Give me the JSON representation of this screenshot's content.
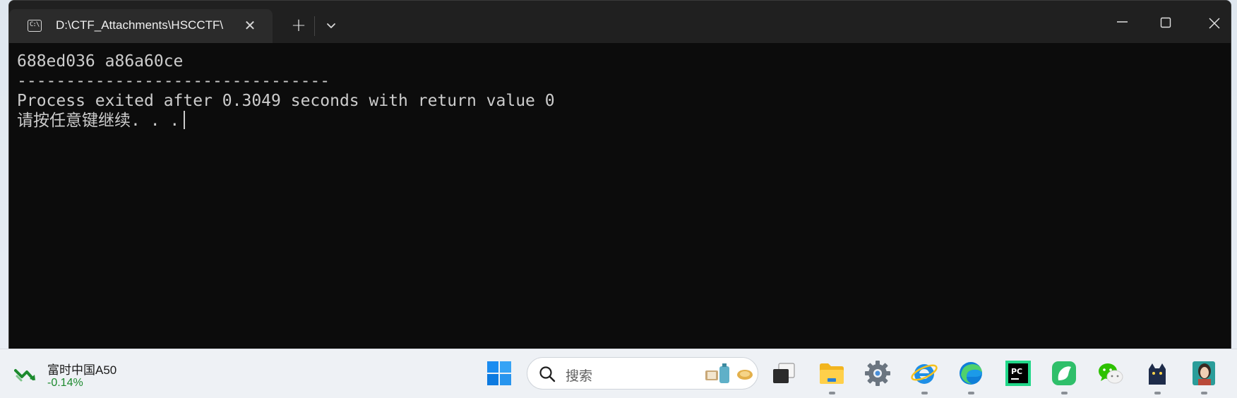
{
  "window": {
    "tab_title": "D:\\CTF_Attachments\\HSCCTF\\",
    "tab_icon_text": "C:\\",
    "close_tab_glyph": "✕",
    "new_tab_glyph": "+"
  },
  "terminal": {
    "lines": [
      "688ed036 a86a60ce",
      "--------------------------------",
      "Process exited after 0.3049 seconds with return value 0",
      "请按任意键继续. . ."
    ]
  },
  "taskbar": {
    "widget": {
      "title": "富时中国A50",
      "change": "-0.14%",
      "change_color": "#1c8a2e"
    },
    "search_placeholder": "搜索",
    "apps": [
      {
        "name": "start-icon"
      },
      {
        "name": "task-view-icon"
      },
      {
        "name": "file-explorer-icon",
        "running": true
      },
      {
        "name": "settings-icon"
      },
      {
        "name": "ie-icon",
        "running": true
      },
      {
        "name": "edge-icon",
        "running": true
      },
      {
        "name": "pycharm-icon"
      },
      {
        "name": "feishu-icon",
        "running": true
      },
      {
        "name": "wechat-icon"
      },
      {
        "name": "cat-icon",
        "running": true
      },
      {
        "name": "avatar-app-icon",
        "running": true
      }
    ]
  },
  "colors": {
    "terminal_bg": "#0c0c0c",
    "terminal_fg": "#cccccc",
    "titlebar_bg": "#202020",
    "tab_bg": "#2b2b2b"
  }
}
